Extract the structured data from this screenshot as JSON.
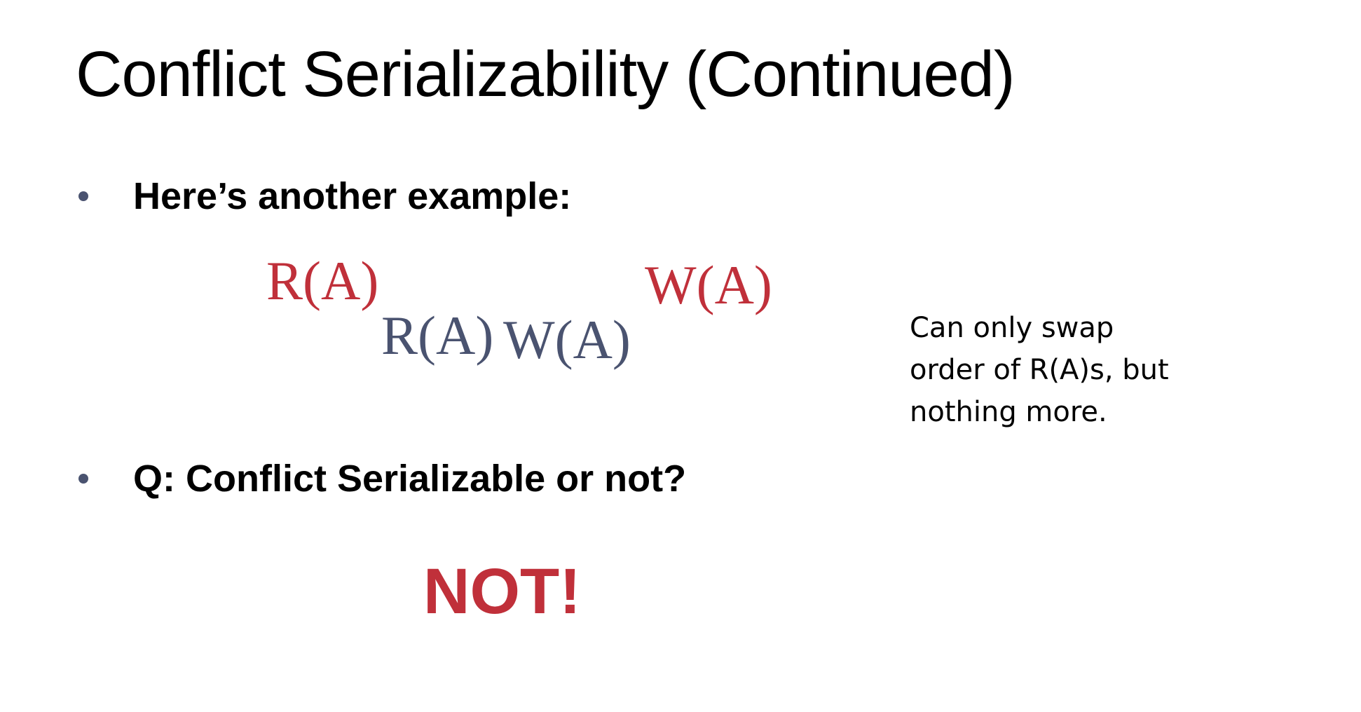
{
  "title": "Conflict Serializability (Continued)",
  "bullets": [
    {
      "text": "Here’s another example:"
    },
    {
      "text": "Q: Conflict Serializable or not?"
    }
  ],
  "schedule": {
    "t1": [
      "R(A)",
      "W(A)"
    ],
    "t2": [
      "R(A)",
      "W(A)"
    ]
  },
  "note": {
    "lines": [
      "Can only swap",
      "order of  R(A)s, but",
      "nothing more."
    ]
  },
  "answer": "NOT!",
  "colors": {
    "t1": "#c0303a",
    "t2": "#4a5370",
    "answer": "#c0303a",
    "bullet": "#4a5370"
  }
}
